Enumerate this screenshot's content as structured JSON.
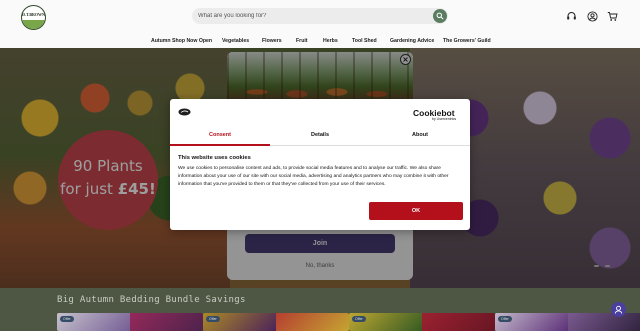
{
  "header": {
    "logo_text": "D.T.BROWN",
    "search_placeholder": "What are you looking for?",
    "icons": [
      "support-icon",
      "account-icon",
      "cart-icon"
    ]
  },
  "nav": [
    {
      "label": "Autumn Shop Now Open"
    },
    {
      "label": "Vegetables"
    },
    {
      "label": "Flowers"
    },
    {
      "label": "Fruit"
    },
    {
      "label": "Herbs"
    },
    {
      "label": "Tool Shed"
    },
    {
      "label": "Gardening Advice"
    },
    {
      "label": "The Growers' Guild"
    }
  ],
  "hero": {
    "promo_line1": "90 Plants",
    "promo_prefix": "for just ",
    "promo_price": "£45!",
    "slide_count": 2
  },
  "newsletter": {
    "join_label": "Join ",
    "no_thanks_label": "No, thanks"
  },
  "cookie": {
    "brand": "Cookiebot",
    "brand_sub": "by Usercentrics",
    "tabs": [
      {
        "label": "Consent",
        "active": true
      },
      {
        "label": "Details",
        "active": false
      },
      {
        "label": "About",
        "active": false
      }
    ],
    "heading": "This website uses cookies",
    "body": "We use cookies to personalise content and ads, to provide social media features and to analyse our traffic. We also share information about your use of our site with our social media, advertising and analytics partners who may combine it with other information that you've provided to them or that they've collected from your use of their services.",
    "ok_label": "OK"
  },
  "section": {
    "title": "Big Autumn Bedding Bundle Savings",
    "products": [
      {
        "badge": "Offer"
      },
      {
        "badge": "Offer"
      },
      {
        "badge": "Offer"
      },
      {
        "badge": "Offer"
      }
    ]
  },
  "colors": {
    "cookie_accent": "#b3101b",
    "join_button": "#4a3f7a",
    "promo_circle": "#c9474e",
    "search_button": "#5a7d62"
  }
}
